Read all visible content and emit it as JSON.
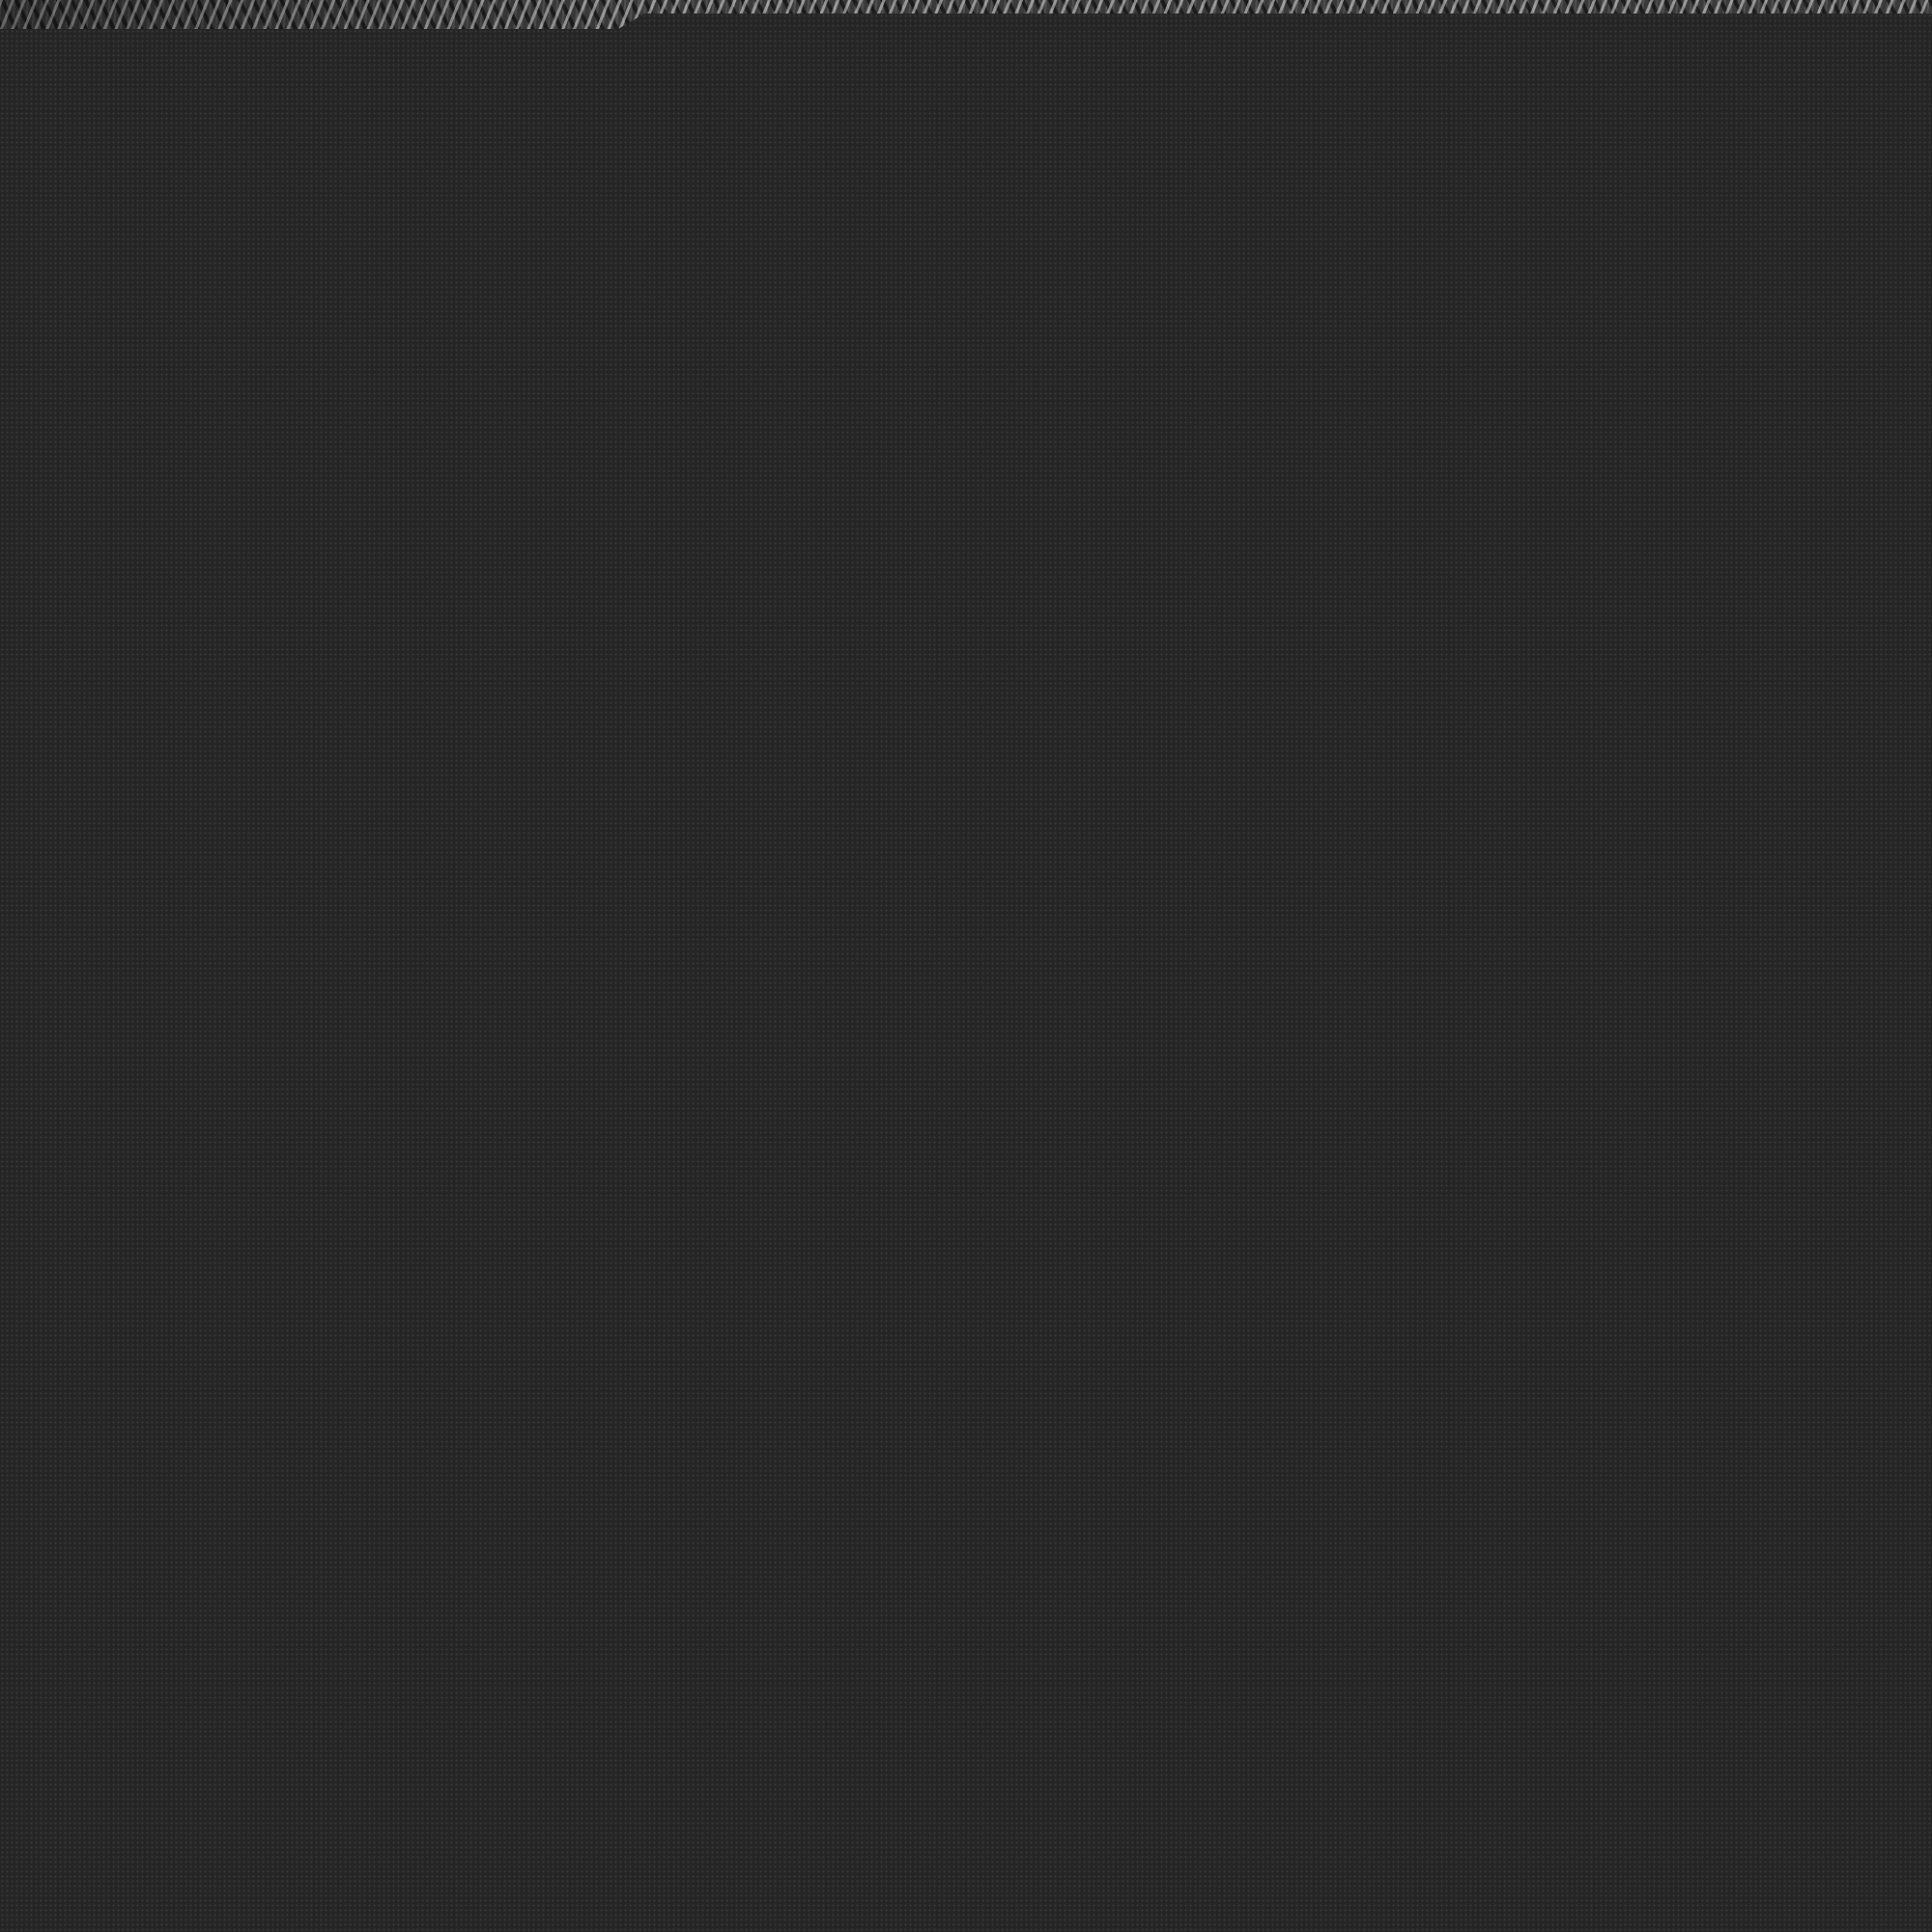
{
  "background": {
    "panel_color": "#252525",
    "texture_colors": [
      "#e6e6e6",
      "#0f0f0f",
      "#787878"
    ]
  }
}
